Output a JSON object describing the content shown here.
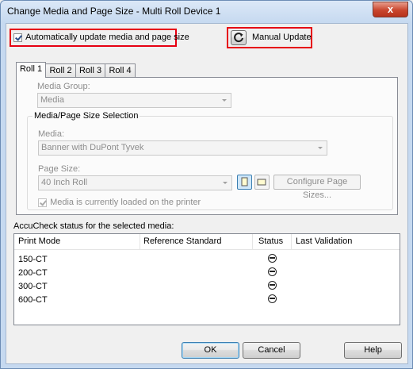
{
  "window": {
    "title": "Change Media and Page Size - Multi Roll Device 1",
    "close_label": "x"
  },
  "auto_update": {
    "label": "Automatically update media and page size",
    "checked": true
  },
  "manual_update": {
    "label": "Manual Update",
    "icon": "refresh-icon"
  },
  "tabs": [
    {
      "label": "Roll 1",
      "active": true
    },
    {
      "label": "Roll 2",
      "active": false
    },
    {
      "label": "Roll 3",
      "active": false
    },
    {
      "label": "Roll 4",
      "active": false
    }
  ],
  "roll": {
    "media_group_label": "Media Group:",
    "media_group_value": "Media",
    "selection_group_title": "Media/Page Size Selection",
    "media_label": "Media:",
    "media_value": "Banner with DuPont Tyvek",
    "page_size_label": "Page Size:",
    "page_size_value": "40 Inch Roll",
    "configure_label": "Configure Page Sizes...",
    "portrait_icon": "portrait-orientation-icon",
    "landscape_icon": "landscape-orientation-icon",
    "loaded_label": "Media is currently loaded on the printer",
    "loaded_checked": true
  },
  "accucheck": {
    "label": "AccuCheck status for the selected media:",
    "columns": [
      "Print Mode",
      "Reference Standard",
      "Status",
      "Last Validation"
    ],
    "rows": [
      {
        "mode": "150-CT",
        "reference": "",
        "status_icon": "not-validated-icon",
        "last": ""
      },
      {
        "mode": "200-CT",
        "reference": "",
        "status_icon": "not-validated-icon",
        "last": ""
      },
      {
        "mode": "300-CT",
        "reference": "",
        "status_icon": "not-validated-icon",
        "last": ""
      },
      {
        "mode": "600-CT",
        "reference": "",
        "status_icon": "not-validated-icon",
        "last": ""
      }
    ]
  },
  "buttons": {
    "ok": "OK",
    "cancel": "Cancel",
    "help": "Help"
  },
  "colors": {
    "highlight": "#e60012",
    "default_button_border": "#3c7fb1"
  }
}
